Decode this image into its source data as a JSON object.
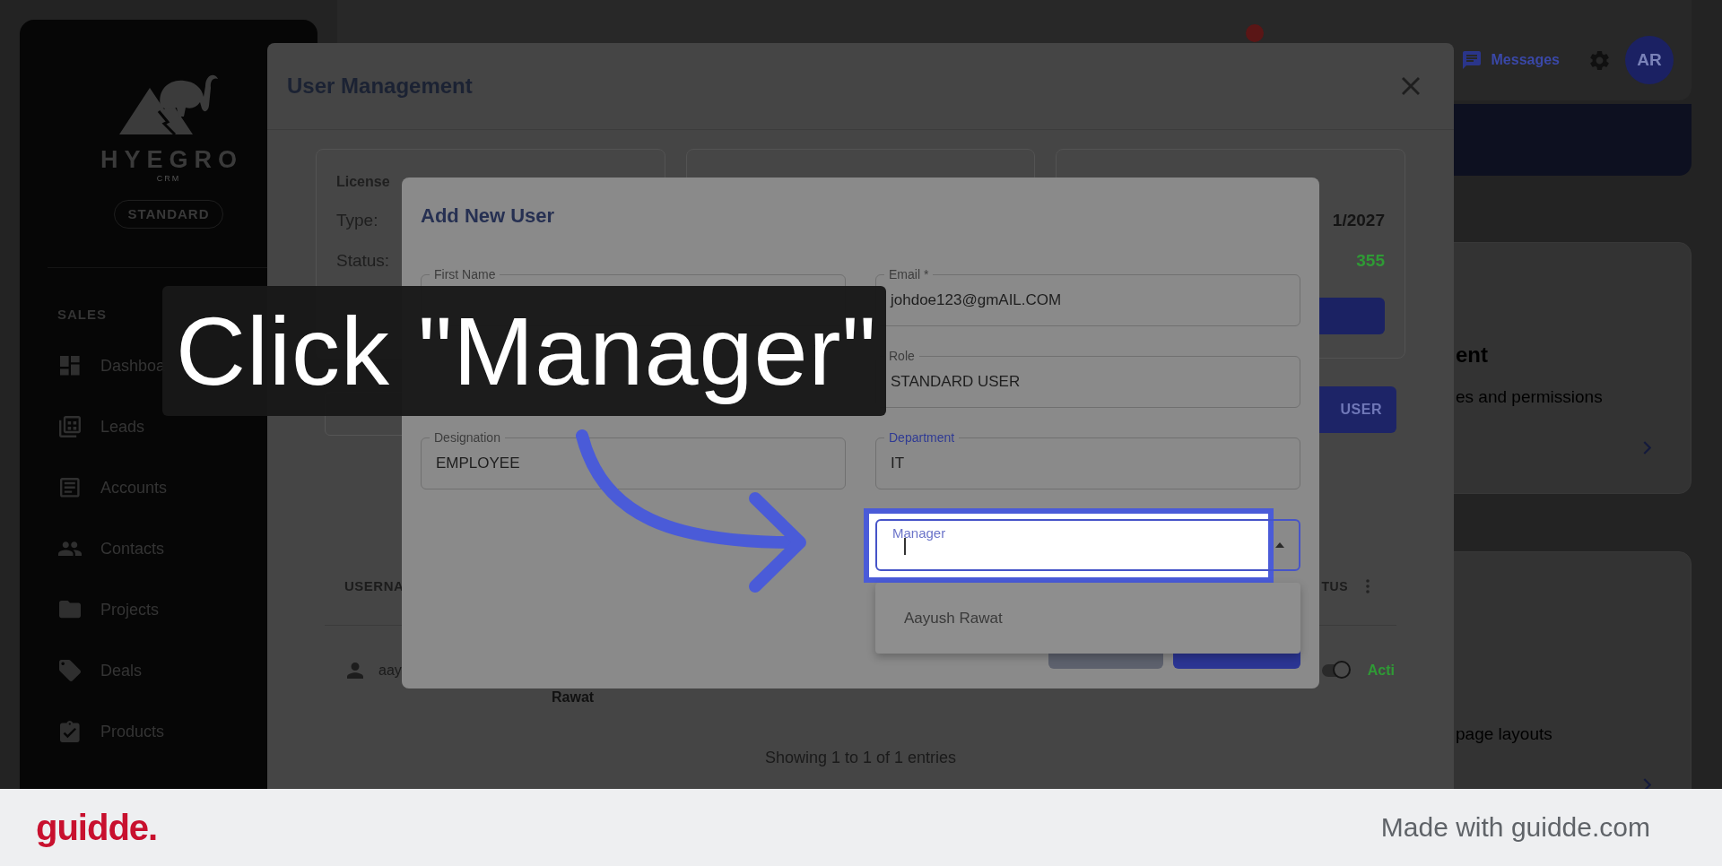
{
  "sidebar": {
    "logo_text": "HYEGRO",
    "logo_subtext": "CRM",
    "plan": "STANDARD",
    "section": "SALES",
    "items": [
      {
        "label": "Dashboa"
      },
      {
        "label": "Leads"
      },
      {
        "label": "Accounts"
      },
      {
        "label": "Contacts"
      },
      {
        "label": "Projects"
      },
      {
        "label": "Deals"
      },
      {
        "label": "Products"
      }
    ]
  },
  "topbar": {
    "messages": "Messages",
    "avatar": "AR"
  },
  "right_panel": {
    "cards": [
      {
        "title": "ent",
        "description": "es and permissions"
      },
      {
        "description": "page layouts"
      }
    ]
  },
  "user_management": {
    "title": "User Management",
    "license_card": {
      "title": "License",
      "rows": [
        {
          "label": "Type:"
        },
        {
          "label": "Status:"
        }
      ]
    },
    "summary_card": {
      "rows": [
        {
          "value": "1/2027",
          "kind": "plain"
        },
        {
          "value": "355",
          "kind": "highlight"
        }
      ]
    },
    "add_button": "USER",
    "table": {
      "columns": [
        {
          "label": "USERNA"
        },
        {
          "label": "TUS"
        }
      ],
      "rows": [
        {
          "username": "aay",
          "name": "Rawat",
          "active": true,
          "status": "Acti"
        }
      ]
    },
    "summary": "Showing 1 to 1 of 1 entries"
  },
  "add_user_dialog": {
    "title": "Add New User",
    "left_fields": [
      {
        "label": "First Name",
        "highlighted": false
      },
      {
        "label": "Designation",
        "value": "EMPLOYEE",
        "highlighted": false
      }
    ],
    "right_fields": [
      {
        "label": "Email *",
        "value": "johdoe123@gmAIL.COM",
        "highlighted": false
      },
      {
        "label": "Role",
        "value": "STANDARD USER",
        "highlighted": false
      },
      {
        "label": "Department",
        "value": "IT",
        "highlighted": true
      }
    ],
    "manager_field": {
      "label": "Manager",
      "focused": true,
      "expanded": true,
      "options": [
        {
          "label": "Aayush Rawat"
        }
      ]
    }
  },
  "tutorial": {
    "caption": "Click \"Manager\""
  },
  "branding": {
    "logo": "guidde.",
    "credit": "Made with guidde.com"
  }
}
